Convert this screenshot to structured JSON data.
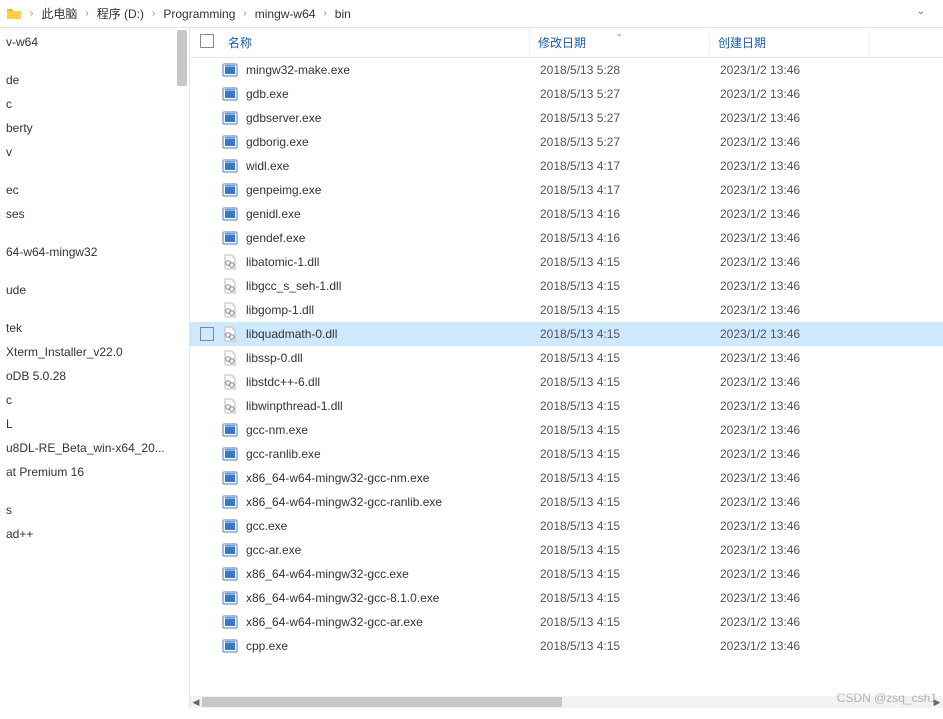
{
  "breadcrumb": {
    "items": [
      "此电脑",
      "程序 (D:)",
      "Programming",
      "mingw-w64",
      "bin"
    ]
  },
  "sidebar": {
    "top_item": "v-w64",
    "group1": [
      "de",
      "c",
      "berty",
      "v"
    ],
    "group2": [
      "ec",
      "ses"
    ],
    "group3": [
      "64-w64-mingw32"
    ],
    "group4": [
      "ude"
    ],
    "group5": [
      "tek",
      "Xterm_Installer_v22.0",
      "oDB 5.0.28",
      "c",
      "L",
      "u8DL-RE_Beta_win-x64_20...",
      "at Premium 16"
    ],
    "group6": [
      "s",
      "ad++"
    ]
  },
  "columns": {
    "name": "名称",
    "modified": "修改日期",
    "created": "创建日期"
  },
  "files": [
    {
      "name": "mingw32-make.exe",
      "type": "exe",
      "mod": "2018/5/13 5:28",
      "create": "2023/1/2 13:46"
    },
    {
      "name": "gdb.exe",
      "type": "exe",
      "mod": "2018/5/13 5:27",
      "create": "2023/1/2 13:46"
    },
    {
      "name": "gdbserver.exe",
      "type": "exe",
      "mod": "2018/5/13 5:27",
      "create": "2023/1/2 13:46"
    },
    {
      "name": "gdborig.exe",
      "type": "exe",
      "mod": "2018/5/13 5:27",
      "create": "2023/1/2 13:46"
    },
    {
      "name": "widl.exe",
      "type": "exe",
      "mod": "2018/5/13 4:17",
      "create": "2023/1/2 13:46"
    },
    {
      "name": "genpeimg.exe",
      "type": "exe",
      "mod": "2018/5/13 4:17",
      "create": "2023/1/2 13:46"
    },
    {
      "name": "genidl.exe",
      "type": "exe",
      "mod": "2018/5/13 4:16",
      "create": "2023/1/2 13:46"
    },
    {
      "name": "gendef.exe",
      "type": "exe",
      "mod": "2018/5/13 4:16",
      "create": "2023/1/2 13:46"
    },
    {
      "name": "libatomic-1.dll",
      "type": "dll",
      "mod": "2018/5/13 4:15",
      "create": "2023/1/2 13:46"
    },
    {
      "name": "libgcc_s_seh-1.dll",
      "type": "dll",
      "mod": "2018/5/13 4:15",
      "create": "2023/1/2 13:46"
    },
    {
      "name": "libgomp-1.dll",
      "type": "dll",
      "mod": "2018/5/13 4:15",
      "create": "2023/1/2 13:46"
    },
    {
      "name": "libquadmath-0.dll",
      "type": "dll",
      "mod": "2018/5/13 4:15",
      "create": "2023/1/2 13:46",
      "selected": true
    },
    {
      "name": "libssp-0.dll",
      "type": "dll",
      "mod": "2018/5/13 4:15",
      "create": "2023/1/2 13:46"
    },
    {
      "name": "libstdc++-6.dll",
      "type": "dll",
      "mod": "2018/5/13 4:15",
      "create": "2023/1/2 13:46"
    },
    {
      "name": "libwinpthread-1.dll",
      "type": "dll",
      "mod": "2018/5/13 4:15",
      "create": "2023/1/2 13:46"
    },
    {
      "name": "gcc-nm.exe",
      "type": "exe",
      "mod": "2018/5/13 4:15",
      "create": "2023/1/2 13:46"
    },
    {
      "name": "gcc-ranlib.exe",
      "type": "exe",
      "mod": "2018/5/13 4:15",
      "create": "2023/1/2 13:46"
    },
    {
      "name": "x86_64-w64-mingw32-gcc-nm.exe",
      "type": "exe",
      "mod": "2018/5/13 4:15",
      "create": "2023/1/2 13:46"
    },
    {
      "name": "x86_64-w64-mingw32-gcc-ranlib.exe",
      "type": "exe",
      "mod": "2018/5/13 4:15",
      "create": "2023/1/2 13:46"
    },
    {
      "name": "gcc.exe",
      "type": "exe",
      "mod": "2018/5/13 4:15",
      "create": "2023/1/2 13:46"
    },
    {
      "name": "gcc-ar.exe",
      "type": "exe",
      "mod": "2018/5/13 4:15",
      "create": "2023/1/2 13:46"
    },
    {
      "name": "x86_64-w64-mingw32-gcc.exe",
      "type": "exe",
      "mod": "2018/5/13 4:15",
      "create": "2023/1/2 13:46"
    },
    {
      "name": "x86_64-w64-mingw32-gcc-8.1.0.exe",
      "type": "exe",
      "mod": "2018/5/13 4:15",
      "create": "2023/1/2 13:46"
    },
    {
      "name": "x86_64-w64-mingw32-gcc-ar.exe",
      "type": "exe",
      "mod": "2018/5/13 4:15",
      "create": "2023/1/2 13:46"
    },
    {
      "name": "cpp.exe",
      "type": "exe",
      "mod": "2018/5/13 4:15",
      "create": "2023/1/2 13:46"
    }
  ],
  "watermark": "CSDN @zsq_csh1"
}
